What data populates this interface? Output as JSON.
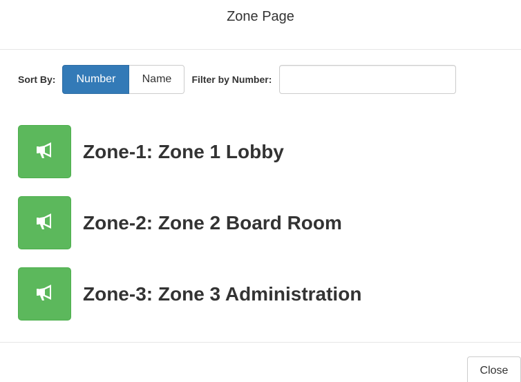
{
  "modal": {
    "title": "Zone Page"
  },
  "controls": {
    "sort_label": "Sort By:",
    "sort_options": [
      {
        "label": "Number",
        "active": true
      },
      {
        "label": "Name",
        "active": false
      }
    ],
    "filter_label": "Filter by Number:",
    "filter_value": "",
    "filter_placeholder": ""
  },
  "zones": [
    {
      "label": "Zone-1: Zone 1 Lobby",
      "icon": "megaphone-icon"
    },
    {
      "label": "Zone-2: Zone 2 Board Room",
      "icon": "megaphone-icon"
    },
    {
      "label": "Zone-3: Zone 3 Administration",
      "icon": "megaphone-icon"
    }
  ],
  "footer": {
    "close_label": "Close"
  },
  "colors": {
    "primary": "#337ab7",
    "success": "#5cb85c",
    "text": "#333333",
    "border": "#cccccc"
  }
}
